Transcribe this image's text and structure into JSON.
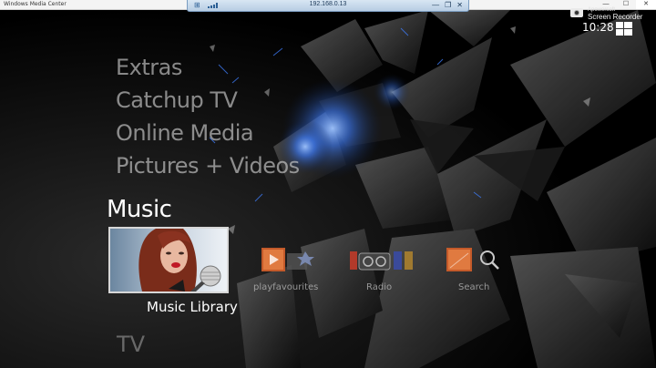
{
  "window": {
    "title": "Windows Media Center",
    "controls": [
      "—",
      "☐",
      "✕"
    ]
  },
  "rdp_bar": {
    "address": "192.168.0.13",
    "icons": [
      "pin-icon",
      "signal-icon",
      "minimize-icon",
      "restore-icon",
      "close-icon"
    ]
  },
  "recorder": {
    "brand": "Apowersoft",
    "name": "Screen Recorder"
  },
  "clock": "10:28",
  "menu": {
    "items": [
      "Extras",
      "Catchup TV",
      "Online Media",
      "Pictures + Videos"
    ],
    "current_section": "Music",
    "next_section": "TV"
  },
  "music_strip": {
    "focused": {
      "label": "Music Library",
      "icon": "album-art-image"
    },
    "tiles": [
      {
        "label": "playfavourites",
        "icon": "playlist-icon"
      },
      {
        "label": "Radio",
        "icon": "radio-icon"
      },
      {
        "label": "Search",
        "icon": "search-icon"
      }
    ]
  },
  "colors": {
    "accent_blue": "#3f7fff",
    "menu_text": "#d7d7d7"
  }
}
